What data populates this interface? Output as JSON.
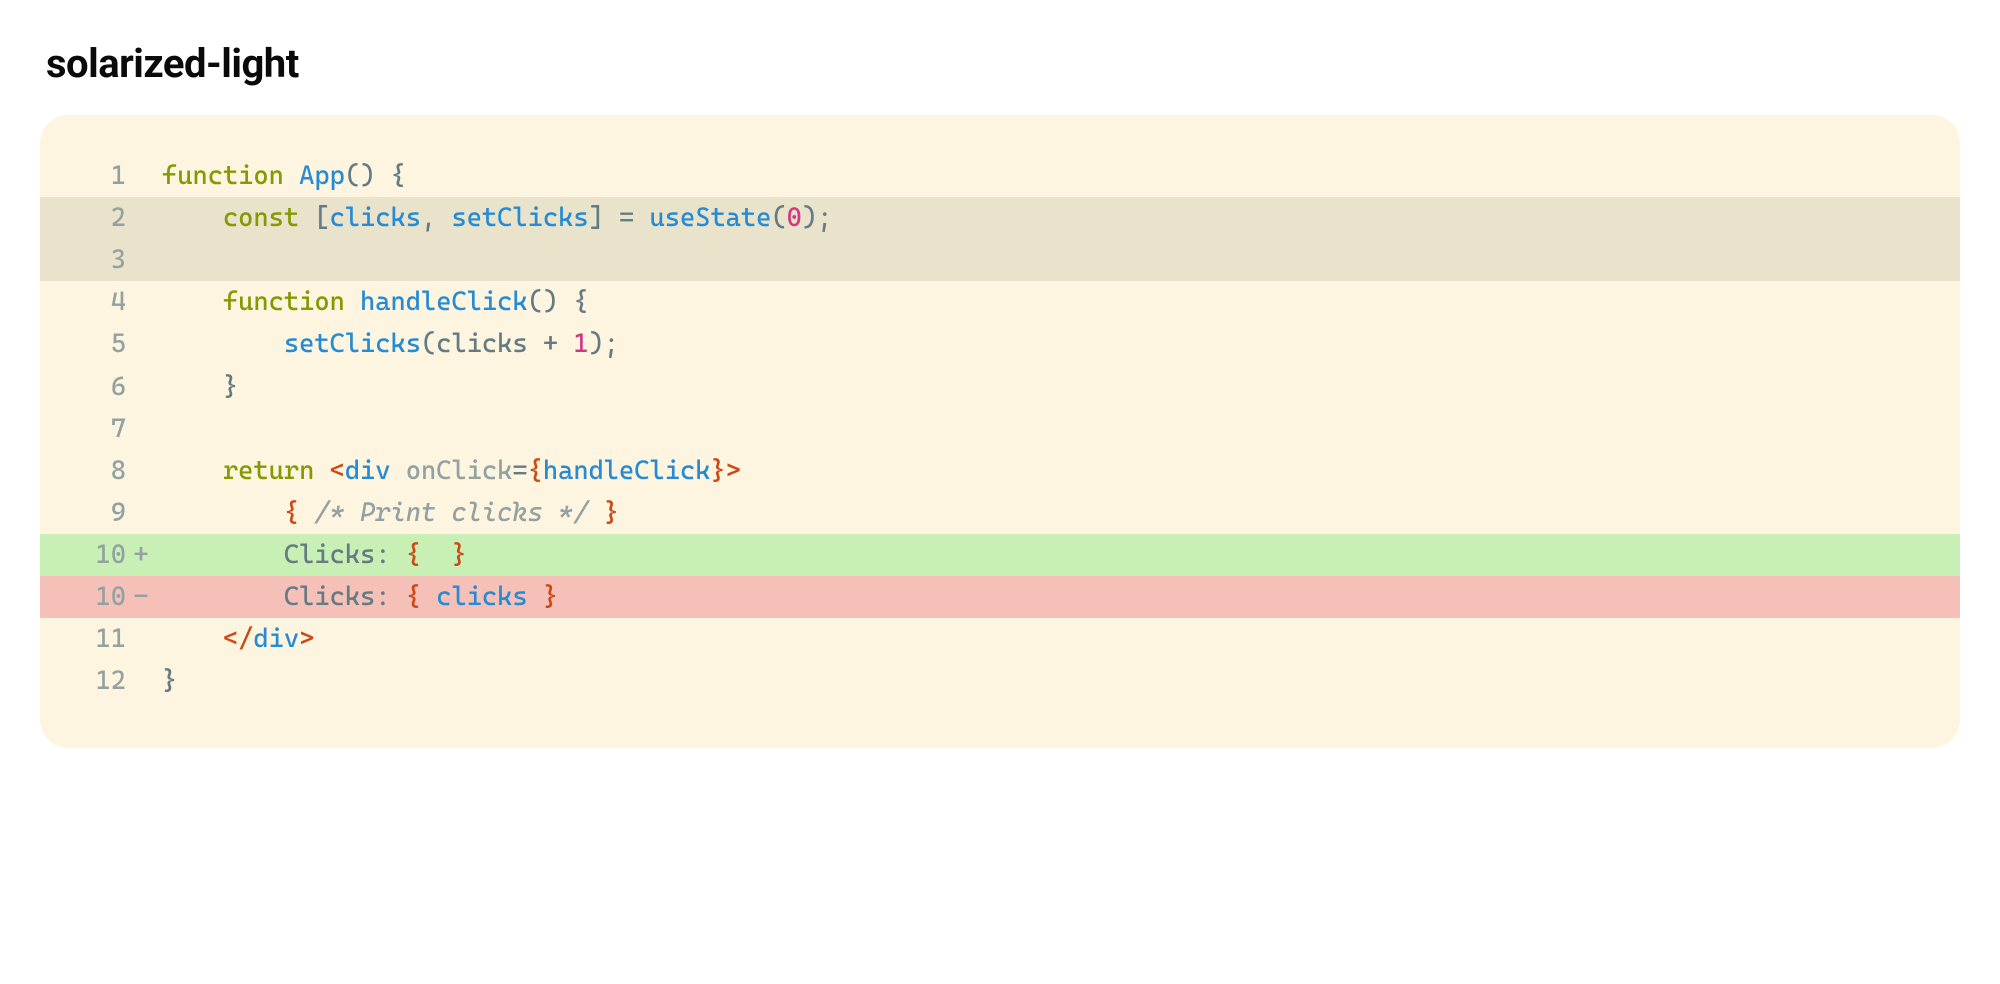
{
  "title": "solarized-light",
  "colors": {
    "background": "#fdf5e0",
    "highlight": "#e9e3cb",
    "added": "#c8f0b5",
    "removed": "#f5c0b8",
    "keyword": "#859900",
    "function": "#268bd2",
    "comment": "#93a1a1",
    "number": "#d33682",
    "base": "#657b83",
    "tag": "#cb4b16"
  },
  "lines": [
    {
      "n": "1",
      "mark": "",
      "class": "",
      "tokens": [
        {
          "c": "t-kw",
          "t": "function"
        },
        {
          "c": "",
          "t": " "
        },
        {
          "c": "t-fn",
          "t": "App"
        },
        {
          "c": "t-pn",
          "t": "()"
        },
        {
          "c": "",
          "t": " "
        },
        {
          "c": "t-pn",
          "t": "{"
        }
      ]
    },
    {
      "n": "2",
      "mark": "",
      "class": "hl",
      "tokens": [
        {
          "c": "",
          "t": "    "
        },
        {
          "c": "t-kw",
          "t": "const"
        },
        {
          "c": "",
          "t": " "
        },
        {
          "c": "t-pn",
          "t": "["
        },
        {
          "c": "t-id",
          "t": "clicks"
        },
        {
          "c": "t-pn",
          "t": ","
        },
        {
          "c": "",
          "t": " "
        },
        {
          "c": "t-id",
          "t": "setClicks"
        },
        {
          "c": "t-pn",
          "t": "]"
        },
        {
          "c": "",
          "t": " "
        },
        {
          "c": "t-pn",
          "t": "="
        },
        {
          "c": "",
          "t": " "
        },
        {
          "c": "t-fn",
          "t": "useState"
        },
        {
          "c": "t-pn",
          "t": "("
        },
        {
          "c": "t-num",
          "t": "0"
        },
        {
          "c": "t-pn",
          "t": ");"
        }
      ]
    },
    {
      "n": "3",
      "mark": "",
      "class": "hl",
      "tokens": [
        {
          "c": "",
          "t": " "
        }
      ]
    },
    {
      "n": "4",
      "mark": "",
      "class": "",
      "tokens": [
        {
          "c": "",
          "t": "    "
        },
        {
          "c": "t-kw",
          "t": "function"
        },
        {
          "c": "",
          "t": " "
        },
        {
          "c": "t-fn",
          "t": "handleClick"
        },
        {
          "c": "t-pn",
          "t": "()"
        },
        {
          "c": "",
          "t": " "
        },
        {
          "c": "t-pn",
          "t": "{"
        }
      ]
    },
    {
      "n": "5",
      "mark": "",
      "class": "",
      "tokens": [
        {
          "c": "",
          "t": "        "
        },
        {
          "c": "t-fn",
          "t": "setClicks"
        },
        {
          "c": "t-pn",
          "t": "("
        },
        {
          "c": "t-var",
          "t": "clicks "
        },
        {
          "c": "t-pn",
          "t": "+"
        },
        {
          "c": "",
          "t": " "
        },
        {
          "c": "t-num",
          "t": "1"
        },
        {
          "c": "t-pn",
          "t": ");"
        }
      ]
    },
    {
      "n": "6",
      "mark": "",
      "class": "",
      "tokens": [
        {
          "c": "",
          "t": "    "
        },
        {
          "c": "t-pn",
          "t": "}"
        }
      ]
    },
    {
      "n": "7",
      "mark": "",
      "class": "",
      "tokens": [
        {
          "c": "",
          "t": " "
        }
      ]
    },
    {
      "n": "8",
      "mark": "",
      "class": "",
      "tokens": [
        {
          "c": "",
          "t": "    "
        },
        {
          "c": "t-kw",
          "t": "return"
        },
        {
          "c": "",
          "t": " "
        },
        {
          "c": "t-tag",
          "t": "<"
        },
        {
          "c": "t-id",
          "t": "div"
        },
        {
          "c": "",
          "t": " "
        },
        {
          "c": "t-attr",
          "t": "onClick"
        },
        {
          "c": "t-pn",
          "t": "="
        },
        {
          "c": "t-brace",
          "t": "{"
        },
        {
          "c": "t-id",
          "t": "handleClick"
        },
        {
          "c": "t-brace",
          "t": "}"
        },
        {
          "c": "t-tag",
          "t": ">"
        }
      ]
    },
    {
      "n": "9",
      "mark": "",
      "class": "",
      "tokens": [
        {
          "c": "",
          "t": "        "
        },
        {
          "c": "t-brace",
          "t": "{"
        },
        {
          "c": "",
          "t": " "
        },
        {
          "c": "t-com",
          "t": "/* Print clicks */"
        },
        {
          "c": "",
          "t": " "
        },
        {
          "c": "t-brace",
          "t": "}"
        }
      ]
    },
    {
      "n": "10",
      "mark": "+",
      "class": "add",
      "tokens": [
        {
          "c": "",
          "t": "        Clicks: "
        },
        {
          "c": "t-brace",
          "t": "{"
        },
        {
          "c": "",
          "t": "  "
        },
        {
          "c": "t-brace",
          "t": "}"
        }
      ]
    },
    {
      "n": "10",
      "mark": "-",
      "class": "del",
      "tokens": [
        {
          "c": "",
          "t": "        Clicks: "
        },
        {
          "c": "t-brace",
          "t": "{"
        },
        {
          "c": "",
          "t": " "
        },
        {
          "c": "t-id",
          "t": "clicks"
        },
        {
          "c": "",
          "t": " "
        },
        {
          "c": "t-brace",
          "t": "}"
        }
      ]
    },
    {
      "n": "11",
      "mark": "",
      "class": "",
      "tokens": [
        {
          "c": "",
          "t": "    "
        },
        {
          "c": "t-tag",
          "t": "</"
        },
        {
          "c": "t-id",
          "t": "div"
        },
        {
          "c": "t-tag",
          "t": ">"
        }
      ]
    },
    {
      "n": "12",
      "mark": "",
      "class": "",
      "tokens": [
        {
          "c": "t-pn",
          "t": "}"
        }
      ]
    }
  ]
}
